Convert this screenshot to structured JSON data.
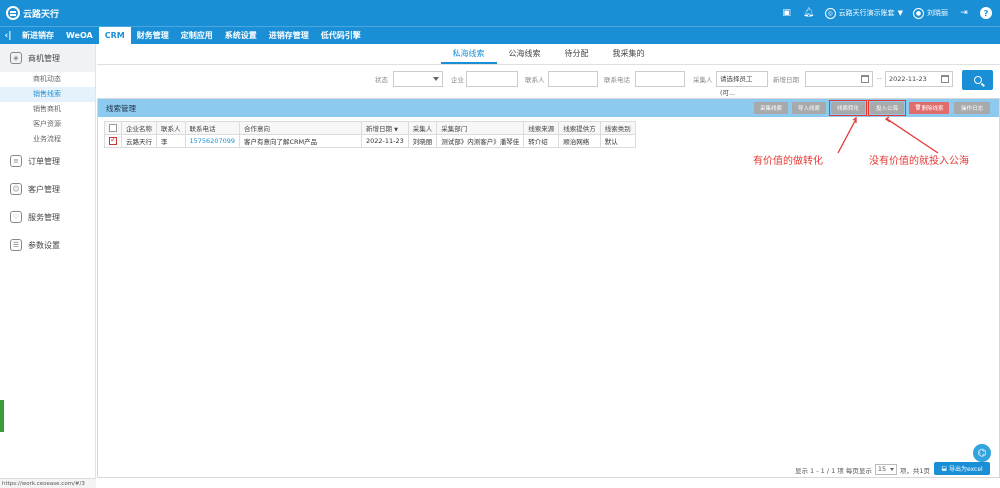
{
  "app": {
    "logo_text": "云路天行",
    "top_icons": [
      "screen-icon",
      "bell-icon"
    ],
    "account": "云路天行演示账套",
    "user": "刘晓丽"
  },
  "nav": {
    "back_symbol": "‹|",
    "items": [
      "新进销存",
      "WeOA",
      "CRM",
      "财务管理",
      "定制应用",
      "系统设置",
      "进销存管理",
      "低代码引擎"
    ],
    "active": "CRM"
  },
  "sidebar": {
    "group_opportunity": "商机管理",
    "sub_items": [
      "商机动态",
      "销售线索",
      "销售商机",
      "客户资源",
      "业务流程"
    ],
    "active_sub": "销售线索",
    "group_order": "订单管理",
    "group_customer": "客户管理",
    "group_service": "服务管理",
    "group_params": "参数设置",
    "status_url": "https://work.ceoease.com/#/3"
  },
  "subtabs": [
    "私海线索",
    "公海线索",
    "待分配",
    "我采集的"
  ],
  "filters": {
    "status_label": "状态",
    "company_label": "企业",
    "contact_label": "联系人",
    "phone_label": "联系电话",
    "collector_label": "采集人",
    "collector_value": "请选择员工 (可...",
    "date_label": "新增日期",
    "date_sep": "--",
    "date_to": "2022-11-23"
  },
  "panel": {
    "title": "线索管理",
    "buttons": {
      "collect": "采集线索",
      "import": "导入线索",
      "convert": "线索转化",
      "to_public": "投入公海",
      "delete": "删除线索",
      "log": "操作日志"
    }
  },
  "table": {
    "headers": [
      "企业名称",
      "联系人",
      "联系电话",
      "合作意向",
      "新增日期",
      "采集人",
      "采集部门",
      "线索来源",
      "线索提供方",
      "线索类别"
    ],
    "sort_mark": "▼",
    "rows": [
      {
        "company": "云路天行",
        "contact": "李",
        "phone": "15756207099",
        "intent": "客户有意向了解CRM产品",
        "date": "2022-11-23",
        "collector": "刘晓丽",
        "dept": "测试部》内测客户》潘琴佳",
        "source": "转介绍",
        "provider": "顺治网络",
        "category": "默认"
      }
    ]
  },
  "annotations": {
    "convert_note": "有价值的做转化",
    "public_note": "没有价值的就投入公海"
  },
  "pager": {
    "info": "显示 1 - 1 / 1 项  每页显示",
    "page_size": "15",
    "suffix": "项，共1页",
    "export": "导出为excel"
  }
}
